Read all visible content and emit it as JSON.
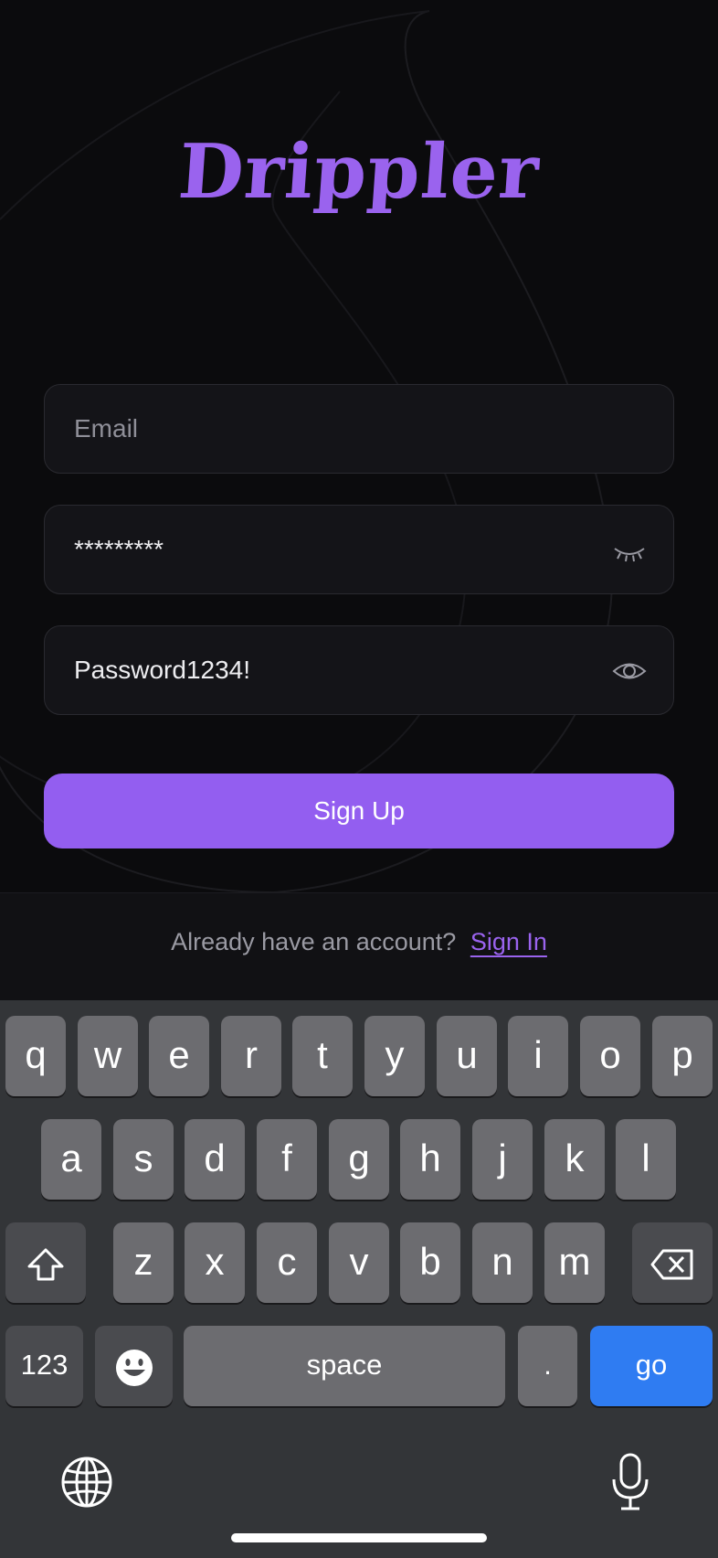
{
  "brand": {
    "logo_text": "Drippler",
    "accent_color": "#935ef0"
  },
  "form": {
    "email": {
      "placeholder": "Email",
      "value": ""
    },
    "password": {
      "value": "*********",
      "toggle_icon": "eye-closed-icon"
    },
    "confirm_password": {
      "value": "Password1234!",
      "toggle_icon": "eye-open-icon"
    },
    "submit_label": "Sign Up"
  },
  "footer": {
    "prompt": "Already have an account?",
    "link": "Sign In"
  },
  "keyboard": {
    "row1": [
      "q",
      "w",
      "e",
      "r",
      "t",
      "y",
      "u",
      "i",
      "o",
      "p"
    ],
    "row2": [
      "a",
      "s",
      "d",
      "f",
      "g",
      "h",
      "j",
      "k",
      "l"
    ],
    "row3": [
      "z",
      "x",
      "c",
      "v",
      "b",
      "n",
      "m"
    ],
    "numbers_label": "123",
    "space_label": "space",
    "period_label": ".",
    "go_label": "go",
    "icons": {
      "shift": "shift-icon",
      "backspace": "backspace-icon",
      "emoji": "emoji-icon",
      "globe": "globe-icon",
      "mic": "microphone-icon"
    },
    "go_color": "#2f7cf2"
  }
}
